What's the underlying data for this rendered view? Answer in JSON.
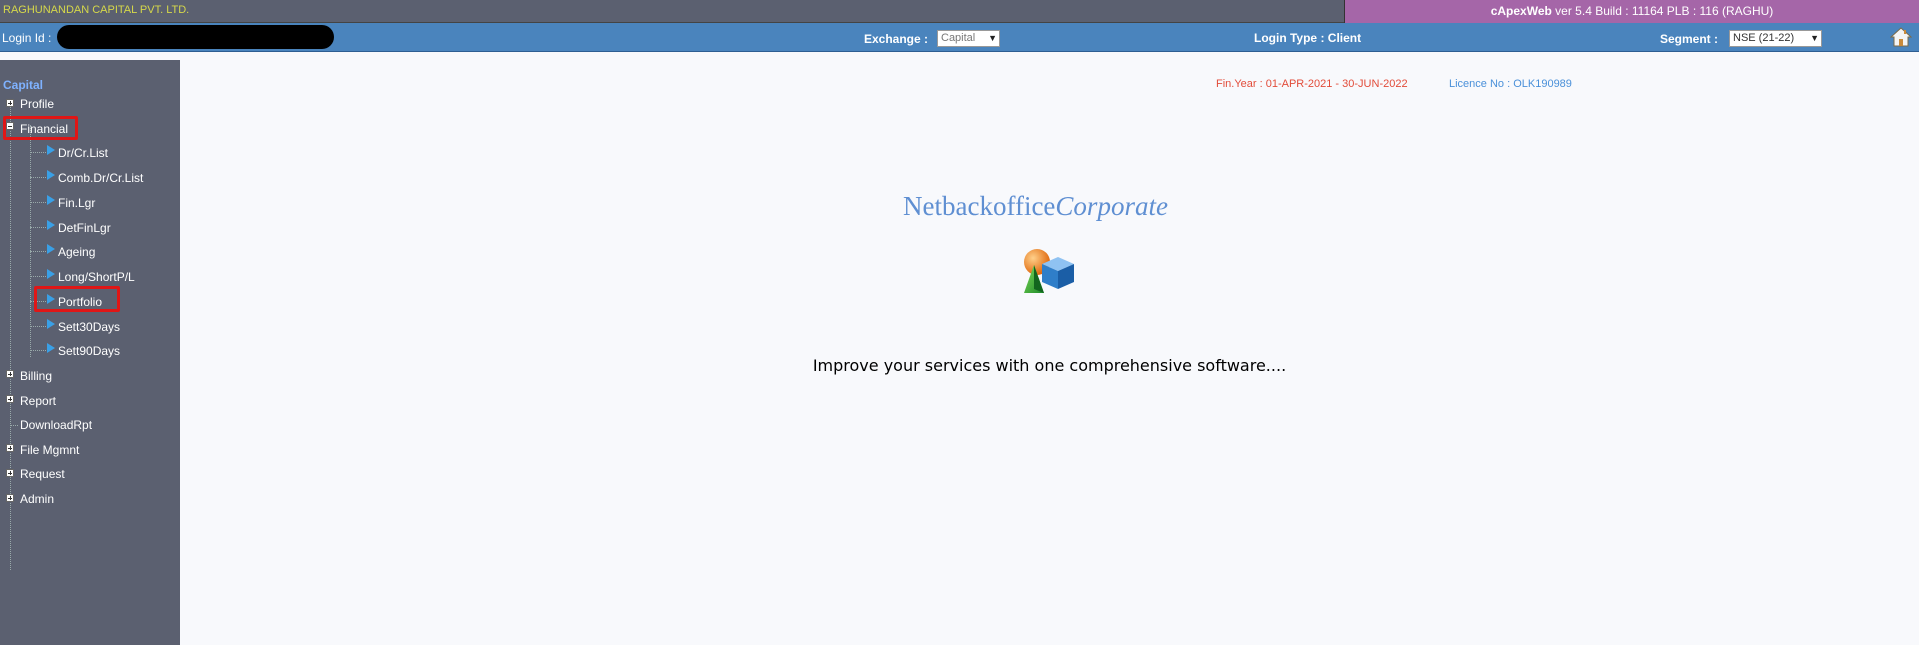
{
  "header": {
    "company": "RAGHUNANDAN CAPITAL PVT. LTD.",
    "app_name": "cApexWeb",
    "version_info": " ver 5.4 Build : 11164  PLB : 116 (RAGHU)"
  },
  "infobar": {
    "login_label": "Login Id :",
    "exchange_label": "Exchange :",
    "exchange_value": "Capital",
    "login_type_label": "Login Type :",
    "login_type_value": "Client",
    "segment_label": "Segment :",
    "segment_value": "NSE (21-22)"
  },
  "sidebar": {
    "title": "Capital",
    "items": [
      {
        "label": "Profile"
      },
      {
        "label": "Financial"
      },
      {
        "label": "Billing"
      },
      {
        "label": "Report"
      },
      {
        "label": "DownloadRpt"
      },
      {
        "label": "File Mgmnt"
      },
      {
        "label": "Request"
      },
      {
        "label": "Admin"
      }
    ],
    "financial_children": [
      {
        "label": "Dr/Cr.List"
      },
      {
        "label": "Comb.Dr/Cr.List"
      },
      {
        "label": "Fin.Lgr"
      },
      {
        "label": "DetFinLgr"
      },
      {
        "label": "Ageing"
      },
      {
        "label": "Long/ShortP/L"
      },
      {
        "label": "Portfolio"
      },
      {
        "label": "Sett30Days"
      },
      {
        "label": "Sett90Days"
      }
    ]
  },
  "main": {
    "fin_year": "Fin.Year : 01-APR-2021 - 30-JUN-2022",
    "licence": "Licence No : OLK190989",
    "brand_main": "Netbackoffice",
    "brand_italic": "Corporate",
    "tagline": "Improve your services with one comprehensive software...."
  },
  "colors": {
    "topbar": "#5b6070",
    "version_bg": "#a566a8",
    "infobar": "#4a84bd",
    "highlight": "#e01616",
    "brand": "#5f8fd2"
  }
}
